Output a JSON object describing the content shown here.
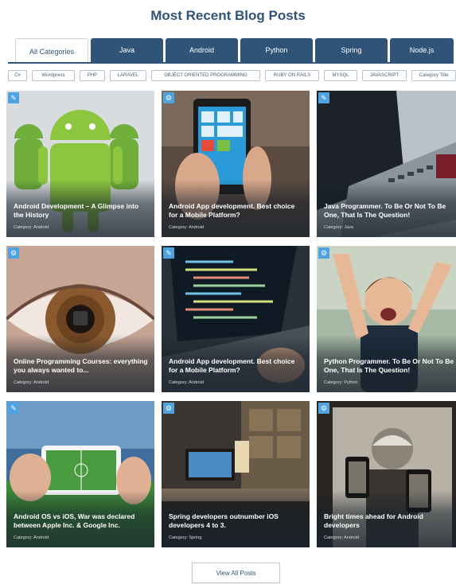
{
  "heading": "Most Recent Blog Posts",
  "tabs": [
    {
      "label": "All Categories",
      "active": true
    },
    {
      "label": "Java",
      "active": false
    },
    {
      "label": "Android",
      "active": false
    },
    {
      "label": "Python",
      "active": false
    },
    {
      "label": "Spring",
      "active": false
    },
    {
      "label": "Node.js",
      "active": false
    }
  ],
  "tags": [
    "C#",
    "Wordpress",
    "PHP",
    "LARAVEL",
    "OBJECT ORIENTED PROGRAMMING",
    "RUBY ON RAILS",
    "MYSQL",
    "JAVASCRIPT",
    "Category Title"
  ],
  "posts": [
    {
      "title": "Android Development – A Glimpse into the History",
      "category": "Category: Android",
      "icon": "pencil-icon"
    },
    {
      "title": "Android App development. Best choice for a Mobile Platform?",
      "category": "Category: Android",
      "icon": "gear-icon"
    },
    {
      "title": "Java Programmer. To Be Or Not To Be One, That Is The Question!",
      "category": "Category: Java",
      "icon": "pencil-icon"
    },
    {
      "title": "Online Programming Courses: everything you always wanted to...",
      "category": "Category: Android",
      "icon": "gear-icon"
    },
    {
      "title": "Android App development. Best choice for a Mobile Platform?",
      "category": "Category: Android",
      "icon": "pencil-icon"
    },
    {
      "title": "Python Programmer. To Be Or Not To Be One, That Is The Question!",
      "category": "Category: Python",
      "icon": "gear-icon"
    },
    {
      "title": "Android OS vs iOS, War was declared between Apple Inc. & Google Inc.",
      "category": "Category: Android",
      "icon": "pencil-icon"
    },
    {
      "title": "Spring developers outnumber iOS developers 4 to 3.",
      "category": "Category: Spring",
      "icon": "gear-icon"
    },
    {
      "title": "Bright times ahead for Android developers",
      "category": "Category: Android",
      "icon": "gear-icon"
    }
  ],
  "view_all_label": "View All Posts",
  "colors": {
    "brand": "#2f5478",
    "badge": "#4fa3e0"
  }
}
